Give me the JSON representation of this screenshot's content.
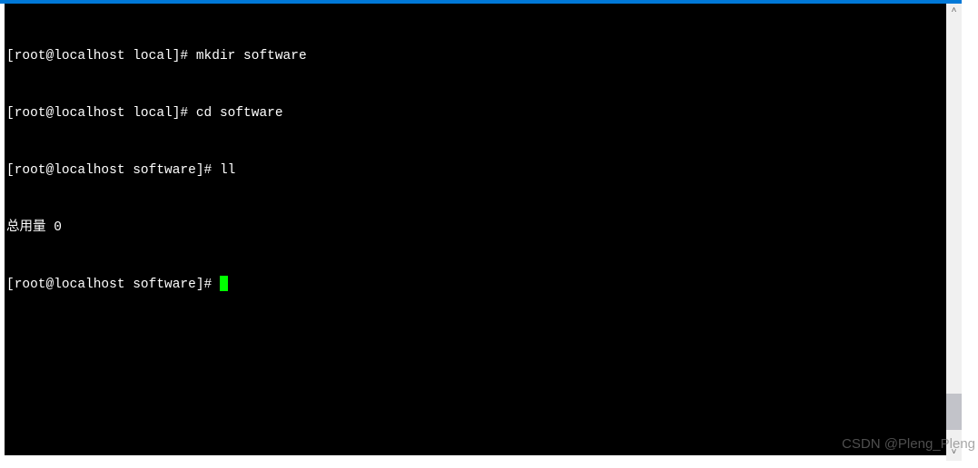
{
  "terminal": {
    "lines": [
      {
        "prompt": "[root@localhost local]# ",
        "command": "mkdir software"
      },
      {
        "prompt": "[root@localhost local]# ",
        "command": "cd software"
      },
      {
        "prompt": "[root@localhost software]# ",
        "command": "ll"
      },
      {
        "output": "总用量 0"
      },
      {
        "prompt": "[root@localhost software]# ",
        "cursor": true
      }
    ]
  },
  "scrollbar": {
    "up_glyph": "˄",
    "down_glyph": "˅"
  },
  "watermark": "CSDN @Pleng_Pleng"
}
